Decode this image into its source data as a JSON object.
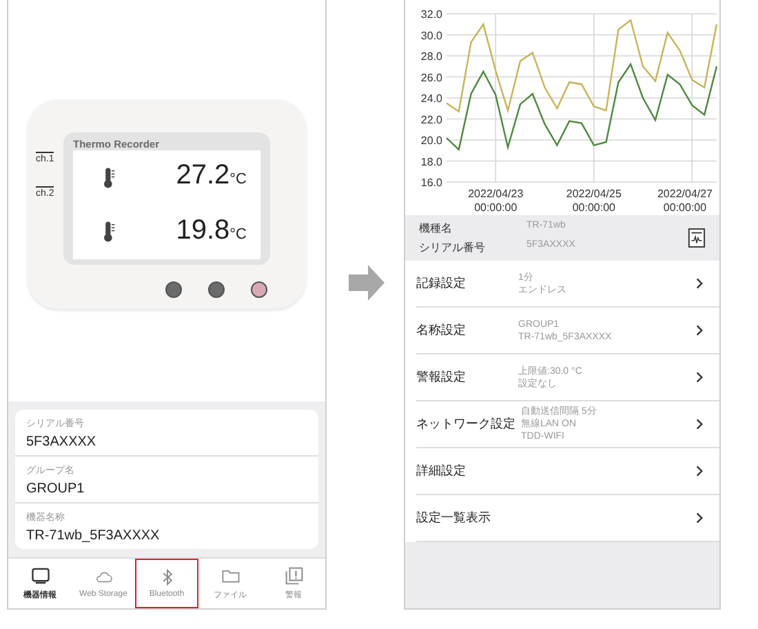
{
  "device_screen": {
    "brand": "Thermo Recorder",
    "channels": [
      {
        "label": "ch.1",
        "value": "27.2",
        "unit": "°C"
      },
      {
        "label": "ch.2",
        "value": "19.8",
        "unit": "°C"
      }
    ],
    "leds": [
      {
        "color": "#6b6b6b"
      },
      {
        "color": "#6b6b6b"
      },
      {
        "color": "#d9aab4"
      }
    ]
  },
  "info_fields": [
    {
      "label": "シリアル番号",
      "value": "5F3AXXXX"
    },
    {
      "label": "グループ名",
      "value": "GROUP1"
    },
    {
      "label": "機器名称",
      "value": "TR-71wb_5F3AXXXX"
    }
  ],
  "tab_bar": [
    {
      "label": "機器情報",
      "selected": true,
      "highlighted": false
    },
    {
      "label": "Web Storage",
      "selected": false,
      "highlighted": false
    },
    {
      "label": "Bluetooth",
      "selected": false,
      "highlighted": true
    },
    {
      "label": "ファイル",
      "selected": false,
      "highlighted": false
    },
    {
      "label": "警報",
      "selected": false,
      "highlighted": false
    }
  ],
  "chart_data": {
    "type": "line",
    "grid": true,
    "categories": [
      null,
      null,
      null,
      null,
      "2022/04/23 00:00:00",
      null,
      null,
      null,
      null,
      null,
      null,
      null,
      "2022/04/25 00:00:00",
      null,
      null,
      null,
      null,
      null,
      null,
      null,
      "2022/04/27 00:00:00",
      null,
      null
    ],
    "series": [
      {
        "color": "#c9b45a",
        "values": [
          23.5,
          22.7,
          29.3,
          31,
          26.6,
          22.8,
          27.5,
          28.3,
          25,
          23,
          25.5,
          25.3,
          23.2,
          22.8,
          30.5,
          31.4,
          27,
          25.6,
          30.2,
          28.5,
          25.7,
          25,
          31
        ]
      },
      {
        "color": "#4e8a3e",
        "values": [
          20.2,
          19.1,
          24.4,
          26.5,
          24.3,
          19.3,
          23.4,
          24.4,
          21.5,
          19.5,
          21.8,
          21.6,
          19.5,
          19.8,
          25.5,
          27.2,
          24,
          21.9,
          26.2,
          25.3,
          23.3,
          22.4,
          27
        ]
      }
    ],
    "ylim": [
      16,
      32
    ],
    "yticks": [
      {
        "value": 16,
        "label": "16.0"
      },
      {
        "value": 18,
        "label": "18.0"
      },
      {
        "value": 20,
        "label": "20.0"
      },
      {
        "value": 22,
        "label": "22.0"
      },
      {
        "value": 24,
        "label": "24.0"
      },
      {
        "value": 26,
        "label": "26.0"
      },
      {
        "value": 28,
        "label": "28.0"
      },
      {
        "value": 30,
        "label": "30.0"
      },
      {
        "value": 32,
        "label": "32.0"
      }
    ]
  },
  "model_info": [
    {
      "label": "機種名",
      "value": "TR-71wb"
    },
    {
      "label": "シリアル番号",
      "value": "5F3AXXXX"
    }
  ],
  "settings": [
    {
      "label": "記録設定",
      "details": [
        "1分",
        "エンドレス"
      ]
    },
    {
      "label": "名称設定",
      "details": [
        "GROUP1",
        "TR-71wb_5F3AXXXX"
      ]
    },
    {
      "label": "警報設定",
      "details": [
        "上限値:30.0 °C",
        "設定なし"
      ]
    },
    {
      "label": "ネットワーク設定",
      "details": [
        "自動送信間隔 5分",
        "無線LAN ON",
        "TDD-WIFI"
      ]
    },
    {
      "label": "詳細設定"
    },
    {
      "label": "設定一覧表示"
    }
  ]
}
